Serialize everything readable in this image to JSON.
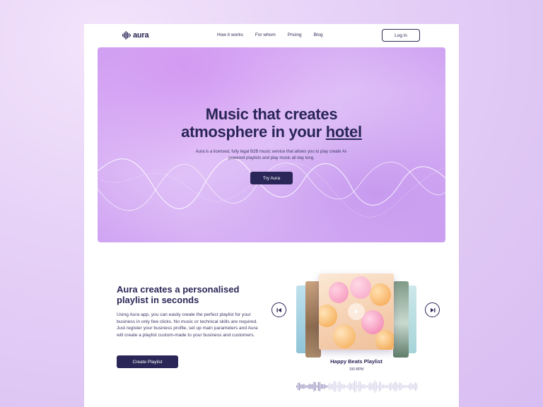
{
  "nav": {
    "logo_text": "aura",
    "links": [
      "How it works",
      "For whom",
      "Pricing",
      "Blog"
    ],
    "login_label": "Log in"
  },
  "hero": {
    "title_line1": "Music that creates",
    "title_line2_prefix": "atmosphere in your ",
    "title_line2_highlight": "hotel",
    "subtitle": "Aura is a licensed, fully legal B2B music service that allows you to play create AI-powered playlists and play music all day long.",
    "cta_label": "Try Aura"
  },
  "feature": {
    "title": "Aura creates a personalised playlist in seconds",
    "body": "Using Aura app, you can easily create the perfect playlist for your business in only few clicks. No music or technical skills are required. Just register your business profile, set up main parameters and Aura will create a playlist custom-made to your business and customers.",
    "cta_label": "Create Playlist"
  },
  "player": {
    "playlist_title": "Happy Beats Playlist",
    "bpm": "100 BPM",
    "prev_icon": "skip-back-icon",
    "next_icon": "skip-forward-icon",
    "play_icon": "play-icon"
  },
  "colors": {
    "brand_dark": "#2a2657",
    "hero_purple": "#d39af2",
    "background": "#e6d1f7"
  }
}
